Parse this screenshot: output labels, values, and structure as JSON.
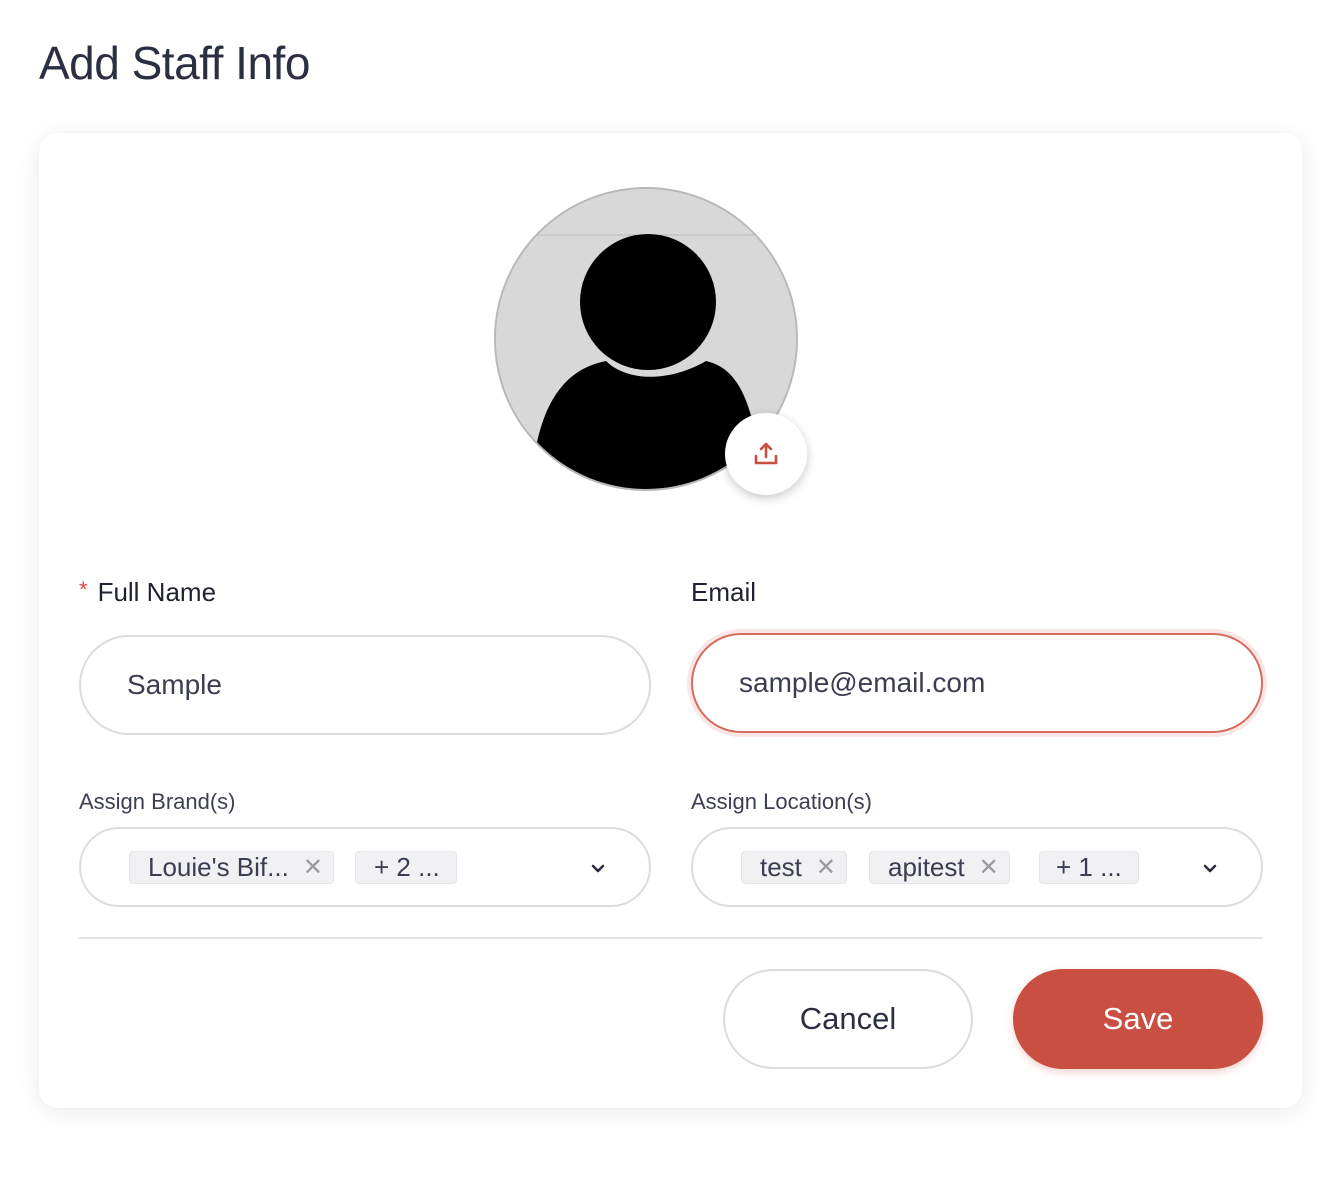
{
  "page": {
    "title": "Add Staff Info"
  },
  "avatar": {
    "icon": "user-silhouette-icon",
    "upload_icon": "upload-icon"
  },
  "form": {
    "full_name": {
      "required_mark": "*",
      "label": "Full Name",
      "value": "Sample"
    },
    "email": {
      "label": "Email",
      "value": "sample@email.com"
    },
    "brands": {
      "label": "Assign Brand(s)",
      "tags": [
        "Louie's Bif..."
      ],
      "more": "+ 2 ..."
    },
    "locations": {
      "label": "Assign Location(s)",
      "tags": [
        "test",
        "apitest"
      ],
      "more": "+ 1 ..."
    }
  },
  "actions": {
    "cancel": "Cancel",
    "save": "Save"
  },
  "colors": {
    "accent": "#c84f42",
    "focus_border": "#d86a5e",
    "text": "#2b2f42"
  }
}
